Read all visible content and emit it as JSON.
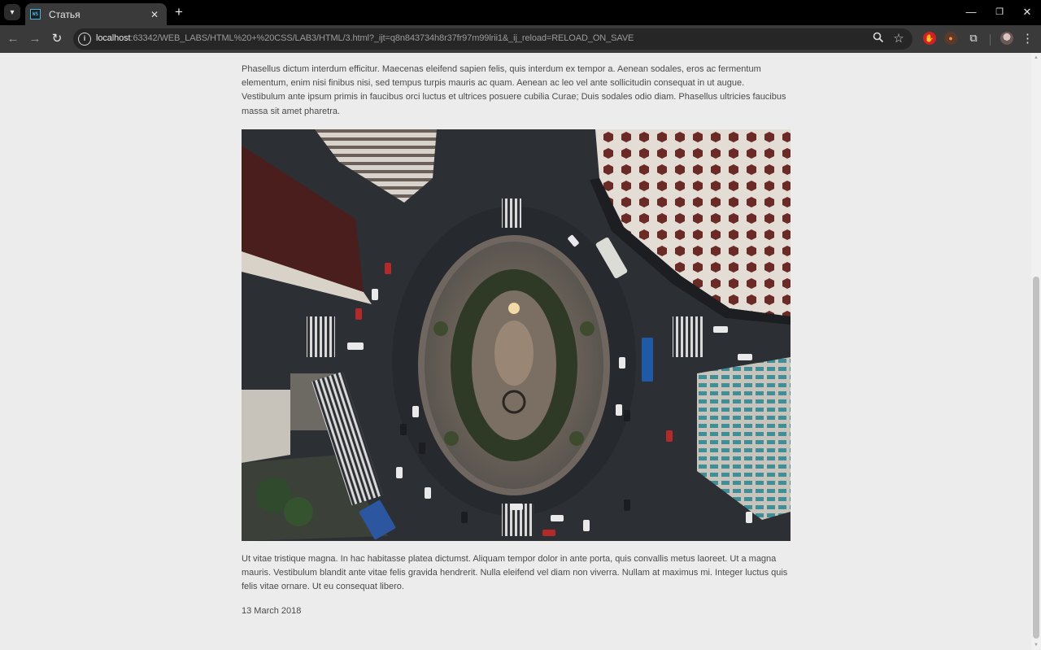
{
  "browser": {
    "tab_title": "Статья",
    "favicon_text": "WS",
    "url_host": "localhost",
    "url_path": ":63342/WEB_LABS/HTML%20+%20CSS/LAB3/HTML/3.html?_ijt=q8n843734h8r37fr97m99lrii1&_ij_reload=RELOAD_ON_SAVE"
  },
  "article": {
    "paragraph_1": "Phasellus dictum interdum efficitur. Maecenas eleifend sapien felis, quis interdum ex tempor a. Aenean sodales, eros ac fermentum elementum, enim nisi finibus nisi, sed tempus turpis mauris ac quam. Aenean ac leo vel ante sollicitudin consequat in ut augue. Vestibulum ante ipsum primis in faucibus orci luctus et ultrices posuere cubilia Curae; Duis sodales odio diam. Phasellus ultricies faucibus massa sit amet pharetra.",
    "paragraph_2": "Ut vitae tristique magna. In hac habitasse platea dictumst. Aliquam tempor dolor in ante porta, quis convallis metus laoreet. Ut a magna mauris. Vestibulum blandit ante vitae felis gravida hendrerit. Nulla eleifend vel diam non viverra. Nullam at maximus mi. Integer luctus quis felis vitae ornare. Ut eu consequat libero.",
    "date": "13 March 2018"
  },
  "icons": {
    "tab_search": "chevron-down-icon",
    "back": "arrow-left-icon",
    "forward": "arrow-right-icon",
    "reload": "reload-icon",
    "site_info": "info-icon",
    "zoom": "magnifier-icon",
    "bookmark": "star-icon",
    "extensions": "puzzle-icon",
    "menu": "three-dots-icon"
  },
  "colors": {
    "page_background": "#ececec",
    "text": "#4a4a4a",
    "chrome_dark": "#000000",
    "toolbar": "#3a3a3a"
  }
}
